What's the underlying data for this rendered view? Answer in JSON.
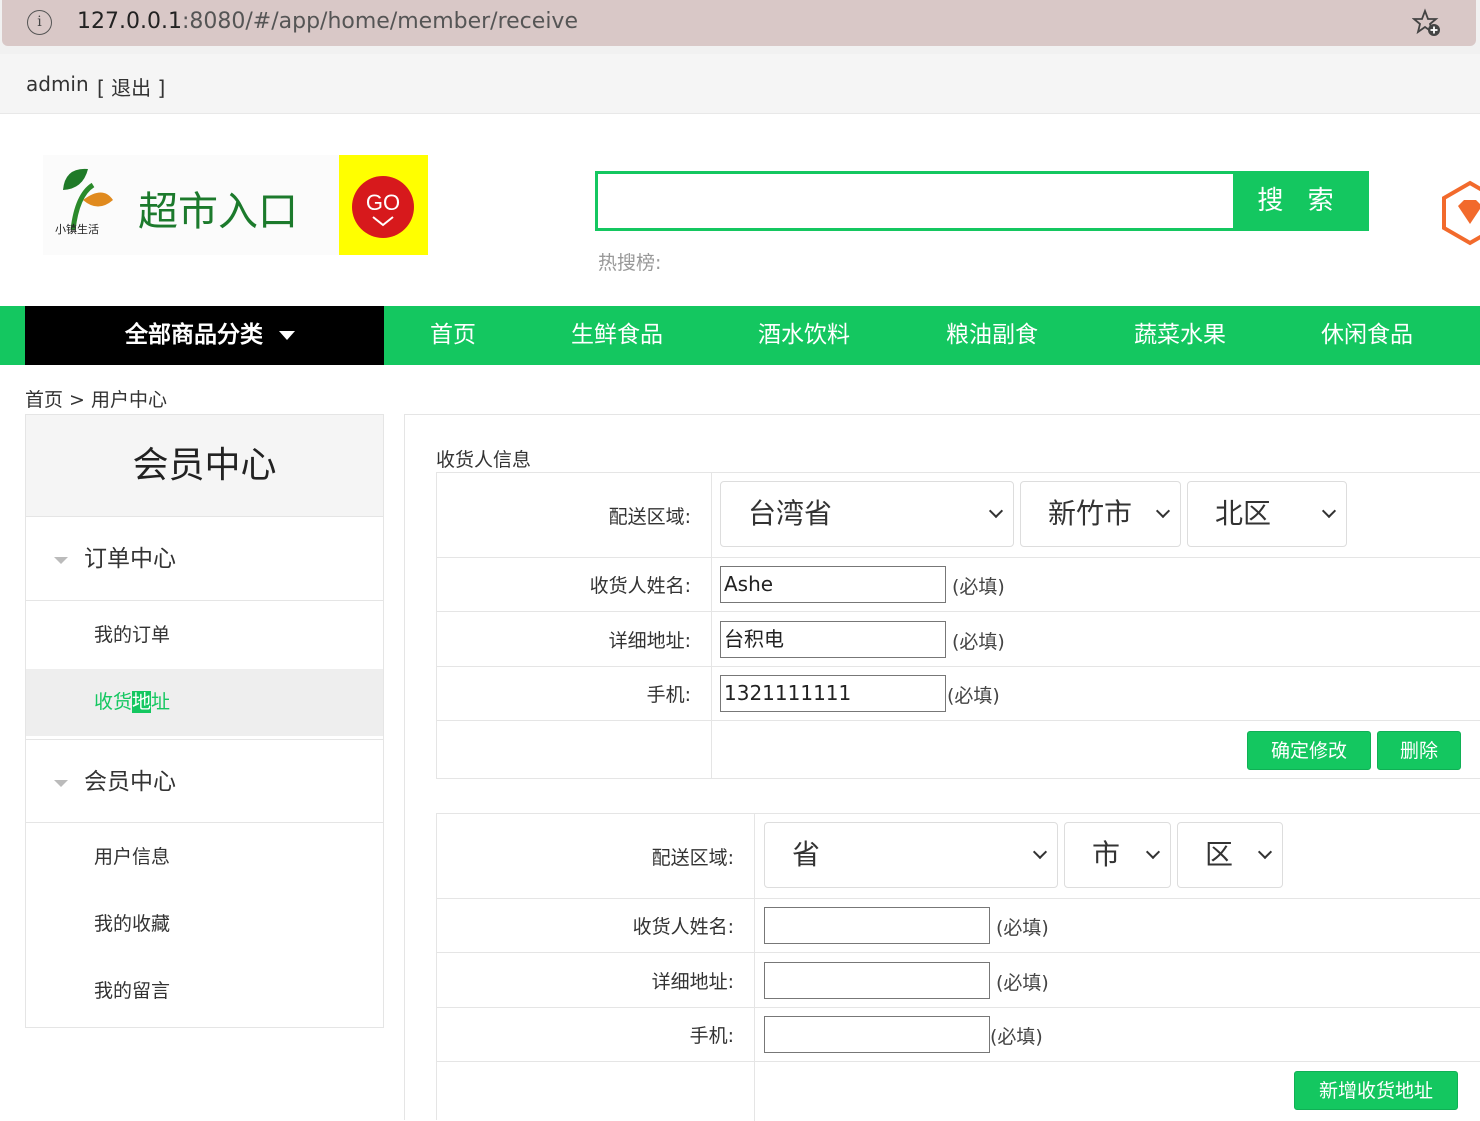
{
  "browser": {
    "url_host": "127.0.0.1",
    "url_rest": ":8080/#/app/home/member/receive"
  },
  "user_bar": {
    "username": "admin",
    "logout": "[ 退出 ]"
  },
  "header": {
    "logo_text": "超市入口",
    "logo_sub": "小镇生活",
    "logo_go": "GO",
    "search_placeholder": "",
    "search_button": "搜 索",
    "hot_search_label": "热搜榜:"
  },
  "nav": {
    "all_categories": "全部商品分类",
    "items": [
      "首页",
      "生鲜食品",
      "酒水饮料",
      "粮油副食",
      "蔬菜水果",
      "休闲食品"
    ]
  },
  "breadcrumb": "首页 > 用户中心",
  "sidebar": {
    "title": "会员中心",
    "group1": "订单中心",
    "group1_items": [
      "我的订单",
      "收货地址"
    ],
    "group2": "会员中心",
    "group2_items": [
      "用户信息",
      "我的收藏",
      "我的留言"
    ]
  },
  "main": {
    "section_title": "收货人信息",
    "labels": {
      "region": "配送区域:",
      "name": "收货人姓名:",
      "address": "详细地址:",
      "phone": "手机:"
    },
    "required": "(必填)",
    "existing": {
      "province": "台湾省",
      "city": "新竹市",
      "district": "北区",
      "name": "Ashe",
      "address": "台积电",
      "phone": "1321111111",
      "confirm_button": "确定修改",
      "delete_button": "删除"
    },
    "new_address": {
      "province": "省",
      "city": "市",
      "district": "区",
      "name": "",
      "address": "",
      "phone": "",
      "add_button": "新增收货地址"
    }
  },
  "colors": {
    "accent": "#14c760",
    "nav_dark": "#000000",
    "logo_yellow": "#ffff00",
    "logo_red": "#d7191c"
  }
}
